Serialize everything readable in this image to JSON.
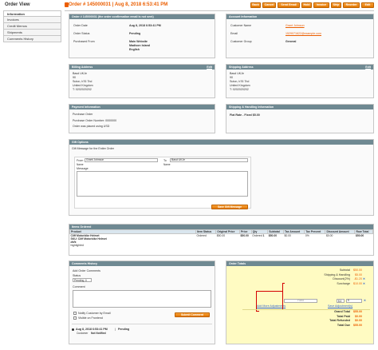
{
  "sidebar": {
    "title": "Order View",
    "tabs": [
      "Information",
      "Invoices",
      "Credit Memos",
      "Shipments",
      "Comments History"
    ]
  },
  "header": {
    "title": "Order # 145000031 | Aug 8, 2018 6:53:41 PM",
    "buttons": [
      "Back",
      "Cancel",
      "Send Email",
      "Hold",
      "Invoice",
      "Ship",
      "Reorder",
      "Edit"
    ]
  },
  "order": {
    "header": "Order # 145000031 (the order confirmation email is not sent)",
    "date_label": "Order Date",
    "date_value": "Aug 8, 2018 6:53:41 PM",
    "status_label": "Order Status",
    "status_value": "Pending",
    "purchased_label": "Purchased From",
    "purchased_value": [
      "Main Website",
      "Madison Island",
      "English"
    ]
  },
  "account": {
    "header": "Account Information",
    "name_label": "Customer Name",
    "name_value": "Grant Johnson",
    "email_label": "Email",
    "email_value": "1529071622@example.com",
    "group_label": "Customer Group",
    "group_value": "General"
  },
  "billing": {
    "header": "Billing Address",
    "edit": "Edit",
    "lines": [
      "Basd UKJe",
      "90",
      "Suton, b76 7hd",
      "United Kingdom",
      "T: 0202020202"
    ]
  },
  "shipping_addr": {
    "header": "Shipping Address",
    "edit": "Edit",
    "lines": [
      "Basd UKJe",
      "90",
      "Suton, b76 7hd",
      "United Kingdom",
      "T: 0202020202"
    ]
  },
  "payment": {
    "header": "Payment Information",
    "lines": [
      "Purchase Order",
      "Purchase Order Number: 0000000",
      "Order was placed using USD"
    ]
  },
  "shipping_method": {
    "header": "Shipping & Handling Information",
    "value": "Flat Rate - Fixed $5.00"
  },
  "gift": {
    "header": "Gift Options",
    "section_label": "Gift Message for the Entire Order",
    "from_label": "From",
    "from_value": "Grant Johnson",
    "to_label": "To",
    "to_value": "Basd UKJe",
    "name_label": "Name",
    "name_label_2": "Name",
    "message_label": "Message",
    "save_button": "Save Gift Message"
  },
  "items": {
    "header": "Items Ordered",
    "columns": [
      "Product",
      "Item Status",
      "Original Price",
      "Price",
      "Qty",
      "Subtotal",
      "Tax Amount",
      "Tax Percent",
      "Discount Amount",
      "Row Total"
    ],
    "row": {
      "name": "Cliff Motorbike Helmet",
      "sku": "SKU: Cliff Motorbike Helmet",
      "opt1": "dsfs",
      "opt2": "highlighted",
      "status": "Ordered",
      "original": "$50.00",
      "price": "$50.00",
      "qty": [
        "Ordered",
        "1"
      ],
      "subtotal": "$50.00",
      "tax": "$0.00",
      "tax_pct": "0%",
      "discount": "$0.00",
      "total": "$50.00"
    }
  },
  "comments": {
    "header": "Comments History",
    "add_label": "Add Order Comments",
    "status_label": "Status",
    "status_value": "Pending",
    "comment_label": "Comment",
    "notify_label": "Notify Customer by Email",
    "visible_label": "Visible on Frontend",
    "submit_button": "Submit Comment",
    "entry_date": "Aug 8, 2018 6:53:41 PM",
    "entry_sep": "|",
    "entry_status": "Pending",
    "entry_notify": "Customer",
    "entry_notify_value": "Not Notified"
  },
  "totals": {
    "header": "Order Totals",
    "rows": [
      {
        "label": "Subtotal",
        "value": "$50.00"
      },
      {
        "label": "Shipping & Handling",
        "value": "$5.00"
      },
      {
        "label": "Discount(2%)",
        "value": "-$1.20"
      },
      {
        "label": "Surcharge",
        "value": "$10.00"
      }
    ],
    "adj_select": "$",
    "adj_placeholder": "Fixed",
    "adj_value": "5",
    "add_more": "Add More Adjustments",
    "save_adj": "Save Adjustment(s)",
    "final": [
      {
        "label": "Grand Total",
        "value": "$55.00",
        "bold": true
      },
      {
        "label": "Total Paid",
        "value": "$0.00",
        "bold": true
      },
      {
        "label": "Total Refunded",
        "value": "$0.00",
        "bold": true
      },
      {
        "label": "Total Due",
        "value": "$55.00",
        "bold": true
      }
    ]
  },
  "colors": {
    "accent": "#eb5e00",
    "panel_header": "#6f8992",
    "highlight": "#fffbc2",
    "annotation": "#d40000"
  }
}
